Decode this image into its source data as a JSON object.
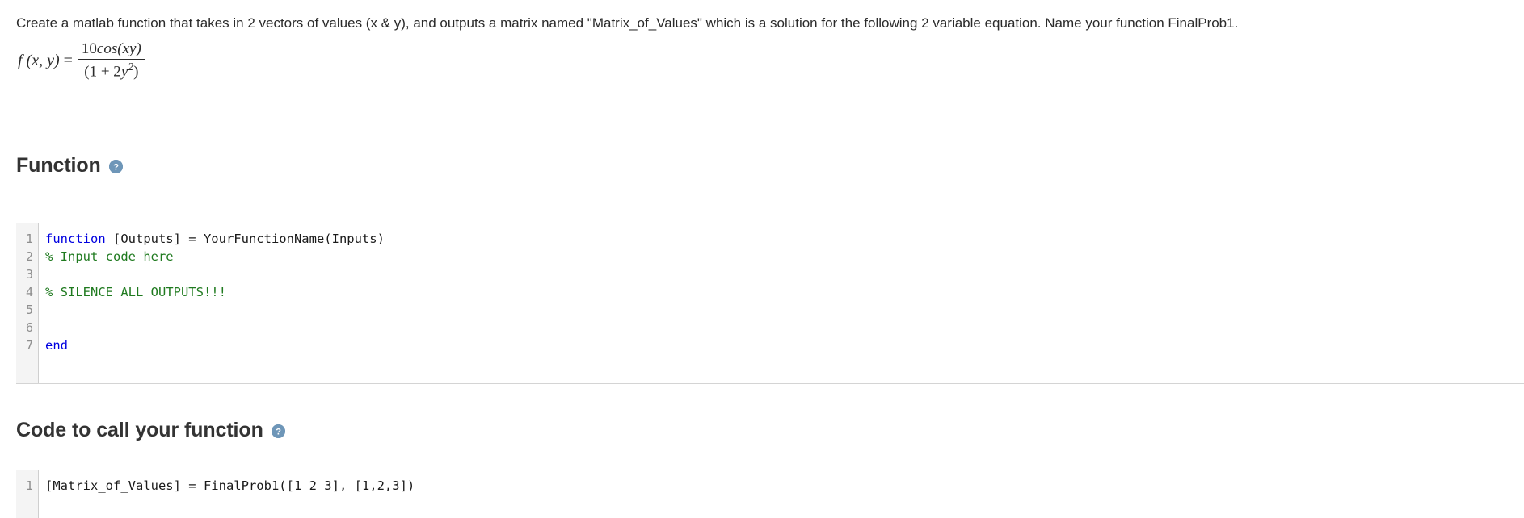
{
  "prompt": {
    "text": "Create a matlab function that takes in 2 vectors of values (x & y), and outputs a matrix named \"Matrix_of_Values\"  which is a solution for the following 2 variable equation.  Name your function FinalProb1."
  },
  "equation": {
    "lhs": "f (x, y)",
    "equals": "=",
    "numerator_coefficient": "10",
    "numerator_function": "cos",
    "numerator_args": "(xy)",
    "denominator_open": "(1 + 2",
    "denominator_var": "y",
    "denominator_exponent": "2",
    "denominator_close": ")",
    "plain": "f(x, y) = 10cos(xy) / (1 + 2y^2)"
  },
  "sections": [
    {
      "title": "Function",
      "help_icon": "help-circle-icon",
      "help_tooltip": "?"
    },
    {
      "title": "Code to call your function",
      "help_icon": "help-circle-icon",
      "help_tooltip": "?"
    }
  ],
  "function_editor": {
    "line_numbers": [
      "1",
      "2",
      "3",
      "4",
      "5",
      "6",
      "7"
    ],
    "lines": [
      [
        {
          "text": "function",
          "type": "keyword"
        },
        {
          "text": " [Outputs] = YourFunctionName(Inputs)",
          "type": "plain"
        }
      ],
      [
        {
          "text": "% Input code here",
          "type": "comment"
        }
      ],
      [
        {
          "text": "",
          "type": "plain"
        }
      ],
      [
        {
          "text": "% SILENCE ALL OUTPUTS!!!",
          "type": "comment"
        }
      ],
      [
        {
          "text": "",
          "type": "plain"
        }
      ],
      [
        {
          "text": "",
          "type": "plain"
        }
      ],
      [
        {
          "text": "end",
          "type": "keyword"
        }
      ]
    ]
  },
  "call_editor": {
    "line_numbers": [
      "1"
    ],
    "lines": [
      [
        {
          "text": "[Matrix_of_Values] = FinalProb1([1 2 3], [1,2,3])",
          "type": "plain"
        }
      ]
    ]
  },
  "colors": {
    "keyword": "#0000e0",
    "comment": "#1f7a1f",
    "plain_code": "#1a1a1a",
    "gutter_bg": "#f4f4f4",
    "gutter_text": "#8e8e8e",
    "border": "#d4d4d4",
    "help_icon_bg": "#6e96b8",
    "heading": "#333333",
    "body_text": "#2b2b2b",
    "page_bg": "#ffffff"
  }
}
